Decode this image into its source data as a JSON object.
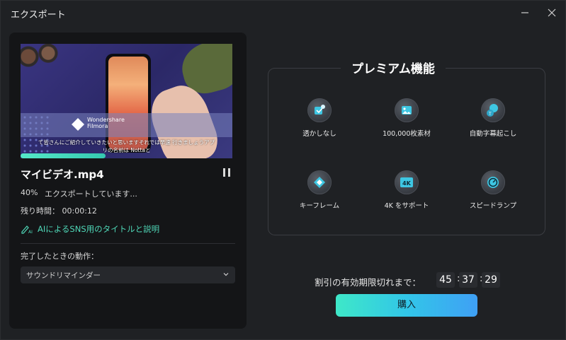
{
  "window": {
    "title": "エクスポート",
    "minimize_icon": "minimize-icon",
    "close_icon": "close-icon"
  },
  "export": {
    "thumbnail": {
      "logo_text_line1": "Wondershare",
      "logo_text_line2": "Filmora",
      "caption_line1": "て皆さんにご紹介していきたいと思いますそれでは早速 行きましょうアプ",
      "caption_line2": "リの名前は Nottaと"
    },
    "progress_percent": 40,
    "file_name": "マイビデオ.mp4",
    "percent_label": "40%",
    "status_text": "エクスポートしています...",
    "time_remaining": "残り時間： 00:00:12",
    "ai_link": "AIによるSNS用のタイトルと説明",
    "after_label": "完了したときの動作：",
    "after_action": "サウンドリマインダー"
  },
  "premium": {
    "title": "プレミアム機能",
    "features": [
      {
        "label": "透かしなし",
        "icon": "no-watermark-icon"
      },
      {
        "label": "100,000枚素材",
        "icon": "image-library-icon"
      },
      {
        "label": "自動字幕起こし",
        "icon": "auto-subtitle-icon"
      },
      {
        "label": "キーフレーム",
        "icon": "keyframe-icon"
      },
      {
        "label": "4K をサポート",
        "icon": "4k-icon"
      },
      {
        "label": "スピードランプ",
        "icon": "speed-ramp-icon"
      }
    ],
    "badge_4k": "4K"
  },
  "promo": {
    "timer_label": "割引の有効期限切れまで：",
    "hours": "45",
    "minutes": "37",
    "seconds": "29",
    "buy_label": "購入"
  },
  "colors": {
    "accent": "#4fd8b8",
    "background": "#1f2124",
    "panel": "#141517"
  }
}
